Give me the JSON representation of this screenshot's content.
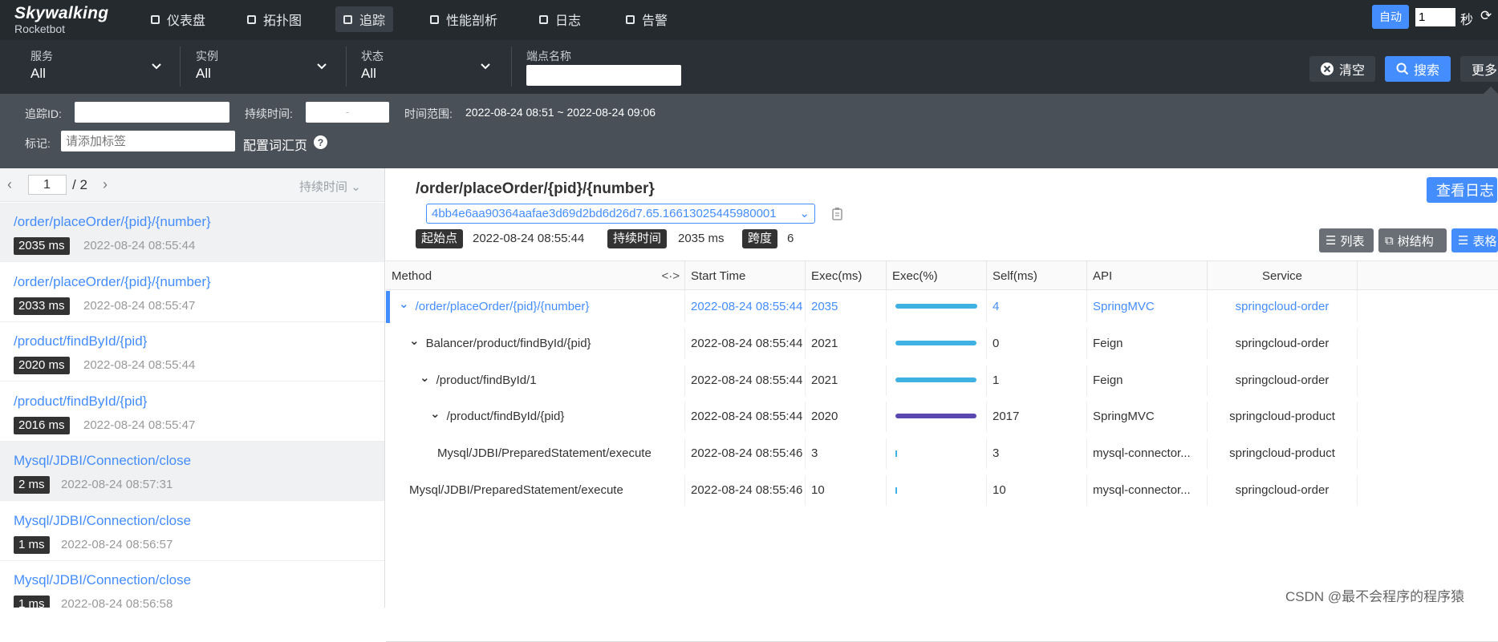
{
  "app": {
    "logo_title": "Skywalking",
    "logo_subtitle": "Rocketbot"
  },
  "nav": [
    {
      "label": "仪表盘",
      "icon": "dashboard-icon"
    },
    {
      "label": "拓扑图",
      "icon": "topology-icon"
    },
    {
      "label": "追踪",
      "icon": "trace-icon",
      "active": true
    },
    {
      "label": "性能剖析",
      "icon": "profile-icon"
    },
    {
      "label": "日志",
      "icon": "log-icon"
    },
    {
      "label": "告警",
      "icon": "alarm-icon"
    }
  ],
  "refresh": {
    "auto_label": "自动",
    "interval_value": "1",
    "unit": "秒"
  },
  "filters": {
    "service": {
      "label": "服务",
      "value": "All"
    },
    "instance": {
      "label": "实例",
      "value": "All"
    },
    "status": {
      "label": "状态",
      "value": "All"
    },
    "endpoint": {
      "label": "端点名称",
      "value": ""
    },
    "clear_label": "清空",
    "search_label": "搜索",
    "more_label": "更多"
  },
  "advanced": {
    "trace_id_label": "追踪ID:",
    "duration_label": "持续时间:",
    "duration_separator": "-",
    "time_range_label": "时间范围:",
    "time_range_value": "2022-08-24 08:51 ~ 2022-08-24 09:06",
    "tags_label": "标记:",
    "tags_placeholder": "请添加标签",
    "config_label": "配置词汇页"
  },
  "list": {
    "page": "1",
    "total": "/ 2",
    "sort_label": "持续时间",
    "items": [
      {
        "endpoint": "/order/placeOrder/{pid}/{number}",
        "duration": "2035 ms",
        "time": "2022-08-24 08:55:44",
        "selected": true
      },
      {
        "endpoint": "/order/placeOrder/{pid}/{number}",
        "duration": "2033 ms",
        "time": "2022-08-24 08:55:47"
      },
      {
        "endpoint": "/product/findById/{pid}",
        "duration": "2020 ms",
        "time": "2022-08-24 08:55:44"
      },
      {
        "endpoint": "/product/findById/{pid}",
        "duration": "2016 ms",
        "time": "2022-08-24 08:55:47"
      },
      {
        "endpoint": "Mysql/JDBI/Connection/close",
        "duration": "2 ms",
        "time": "2022-08-24 08:57:31",
        "selected": true
      },
      {
        "endpoint": "Mysql/JDBI/Connection/close",
        "duration": "1 ms",
        "time": "2022-08-24 08:56:57"
      },
      {
        "endpoint": "Mysql/JDBI/Connection/close",
        "duration": "1 ms",
        "time": "2022-08-24 08:56:58"
      }
    ]
  },
  "detail": {
    "title": "/order/placeOrder/{pid}/{number}",
    "view_log_label": "查看日志",
    "trace_id": "4bb4e6aa90364aafae3d69d2bd6d26d7.65.16613025445980001",
    "start_label": "起始点",
    "start_value": "2022-08-24 08:55:44",
    "duration_label": "持续时间",
    "duration_value": "2035 ms",
    "span_label": "跨度",
    "span_value": "6",
    "view_list_label": "列表",
    "view_tree_label": "树结构",
    "view_table_label": "表格",
    "columns": [
      "Method",
      "Start Time",
      "Exec(ms)",
      "Exec(%)",
      "Self(ms)",
      "API",
      "Service"
    ],
    "rows": [
      {
        "method": "/order/placeOrder/{pid}/{number}",
        "start": "2022-08-24 08:55:44",
        "exec": "2035",
        "exec_pct": 1.0,
        "self": "4",
        "api": "SpringMVC",
        "service": "springcloud-order",
        "level": 0,
        "expandable": true,
        "highlight": true,
        "bar_color": "#3fb1e3"
      },
      {
        "method": "Balancer/product/findById/{pid}",
        "start": "2022-08-24 08:55:44",
        "exec": "2021",
        "exec_pct": 0.993,
        "self": "0",
        "api": "Feign",
        "service": "springcloud-order",
        "level": 1,
        "expandable": true,
        "bar_color": "#3fb1e3"
      },
      {
        "method": "/product/findById/1",
        "start": "2022-08-24 08:55:44",
        "exec": "2021",
        "exec_pct": 0.993,
        "self": "1",
        "api": "Feign",
        "service": "springcloud-order",
        "level": 2,
        "expandable": true,
        "bar_color": "#3fb1e3"
      },
      {
        "method": "/product/findById/{pid}",
        "start": "2022-08-24 08:55:44",
        "exec": "2020",
        "exec_pct": 0.993,
        "self": "2017",
        "api": "SpringMVC",
        "service": "springcloud-product",
        "level": 3,
        "expandable": true,
        "bar_color": "#5a47b0"
      },
      {
        "method": "Mysql/JDBI/PreparedStatement/execute",
        "start": "2022-08-24 08:55:46",
        "exec": "3",
        "exec_pct": 0.0015,
        "self": "3",
        "api": "mysql-connector...",
        "service": "springcloud-product",
        "level": 4,
        "expandable": false,
        "bar_color": "#3fb1e3"
      },
      {
        "method": "Mysql/JDBI/PreparedStatement/execute",
        "start": "2022-08-24 08:55:46",
        "exec": "10",
        "exec_pct": 0.005,
        "self": "10",
        "api": "mysql-connector...",
        "service": "springcloud-order",
        "level": 1,
        "expandable": false,
        "bar_color": "#3fb1e3"
      }
    ]
  },
  "watermark": "CSDN @最不会程序的程序猿"
}
